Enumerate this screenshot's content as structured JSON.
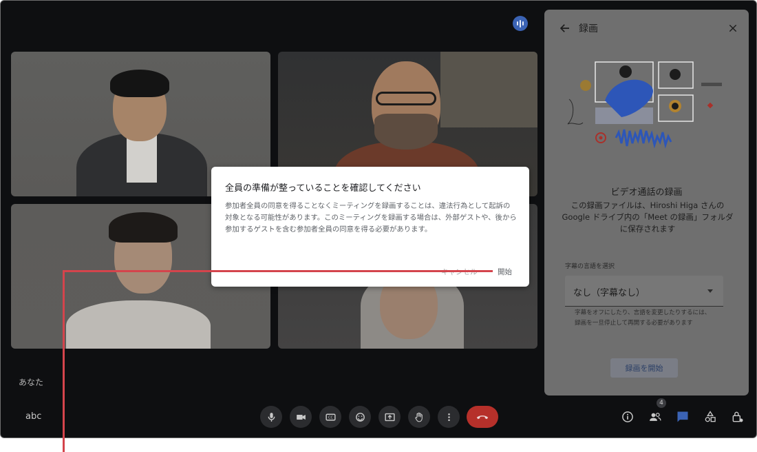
{
  "meeting": {
    "self_label": "あなた",
    "meeting_code": "abc",
    "participants_count": "4"
  },
  "controls": {
    "mic_icon": "mic-icon",
    "camera_icon": "camera-icon",
    "captions_icon": "closed-captions-icon",
    "emoji_icon": "emoji-icon",
    "present_icon": "present-screen-icon",
    "hand_icon": "raise-hand-icon",
    "more_icon": "more-vertical-icon",
    "end_icon": "end-call-icon",
    "end_color": "#b6302a"
  },
  "recording_panel": {
    "title": "録画",
    "heading": "ビデオ通話の録画",
    "description": "この録画ファイルは、Hiroshi Higa さんの Google ドライブ内の「Meet の録画」フォルダに保存されます",
    "caption_language_label": "字幕の言語を選択",
    "caption_language_value": "なし（字幕なし）",
    "caption_help": "字幕をオフにしたり、言語を変更したりするには、録画を一旦停止して再開する必要があります",
    "start_button": "録画を開始"
  },
  "consent_dialog": {
    "title": "全員の準備が整っていることを確認してください",
    "body": "参加者全員の同意を得ることなくミーティングを録画することは、違法行為として起訴の対象となる可能性があります。このミーティングを録画する場合は、外部ゲストや、後から参加するゲストを含む参加者全員の同意を得る必要があります。",
    "cancel_label": "キャンセル",
    "start_label": "開始"
  },
  "colors": {
    "accent_blue": "#3b63b4",
    "annotation_red": "#d4444c"
  }
}
